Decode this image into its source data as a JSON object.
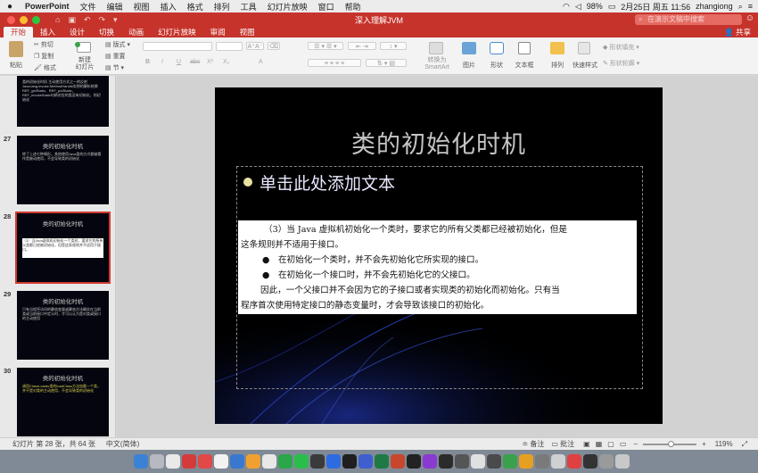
{
  "menubar": {
    "app": "PowerPoint",
    "items": [
      "文件",
      "编辑",
      "视图",
      "插入",
      "格式",
      "排列",
      "工具",
      "幻灯片放映",
      "窗口",
      "帮助"
    ],
    "battery": "98%",
    "datetime": "2月25日 周五 11:56",
    "user": "zhangiong"
  },
  "window": {
    "title": "深入理解JVM",
    "search_placeholder": "在演示文稿中搜索"
  },
  "ribbon": {
    "tabs": [
      "开始",
      "插入",
      "设计",
      "切换",
      "动画",
      "幻灯片放映",
      "审阅",
      "视图"
    ],
    "active_tab": "开始",
    "share": "共享",
    "clipboard": {
      "paste": "粘贴",
      "cut": "剪切",
      "copy": "复制",
      "format": "格式"
    },
    "slides": {
      "new_slide": "新建\n幻灯片",
      "layout": "版式",
      "reset": "重置",
      "section": "节"
    },
    "font": {
      "bold": "B",
      "italic": "I",
      "underline": "U",
      "strike": "abc",
      "super": "X²",
      "sub": "X₂",
      "color": "A"
    },
    "convert": "转换为\nSmartArt",
    "picture": "图片",
    "shape": "形状",
    "textbox": "文本框",
    "arrange": "排列",
    "quick_styles": "快速样式",
    "shape_fill": "形状填充",
    "shape_outline": "形状轮廓"
  },
  "thumbnails": [
    {
      "num": "",
      "title": "",
      "body": "类的初始化时机 主动使用方式之一的反射 Java.lang.invoke.MethodHandle实例的解析结果REF_getStatic、REF_putStatic、REF_invokeStatic句柄对应的类没有初始化，则初始化"
    },
    {
      "num": "27",
      "title": "类的初始化时机",
      "body": "除了上述七种情形，其他使用Java类的方式都被看作是被动使用，不会导致类的初始化"
    },
    {
      "num": "28",
      "title": "类的初始化时机",
      "body": "（3）当Java虚拟机初始化一个类时，要求它的所有父类都已经被初始化，但是这条规则并不适用于接口。"
    },
    {
      "num": "29",
      "title": "类的初始化时机",
      "body": "只有当程序访问的静态变量或静态方法确实在当前类或当前接口中定义时，才可以认为是对类或接口的主动使用"
    },
    {
      "num": "30",
      "title": "类的初始化时机",
      "body": "调用ClassLoader类的loadClass方法加载一个类，并不是对类的主动使用，不会导致类的初始化"
    }
  ],
  "slide": {
    "title": "类的初始化时机",
    "placeholder_text": "单击此处添加文本",
    "paragraph_lines": [
      "（3）当 Java 虚拟机初始化一个类时，要求它的所有父类都已经被初始化，但是",
      "这条规则并不适用于接口。",
      "●　在初始化一个类时，并不会先初始化它所实现的接口。",
      "●　在初始化一个接口时，并不会先初始化它的父接口。",
      "因此，一个父接口并不会因为它的子接口或者实现类的初始化而初始化。只有当",
      "程序首次使用特定接口的静态变量时，才会导致该接口的初始化。"
    ]
  },
  "statusbar": {
    "slide_info": "幻灯片 第 28 张，共 64 张",
    "language": "中文(简体)",
    "notes": "备注",
    "comments": "批注",
    "zoom": "119%"
  },
  "colors": {
    "accent": "#c6332b",
    "slide_bg": "#000000"
  }
}
